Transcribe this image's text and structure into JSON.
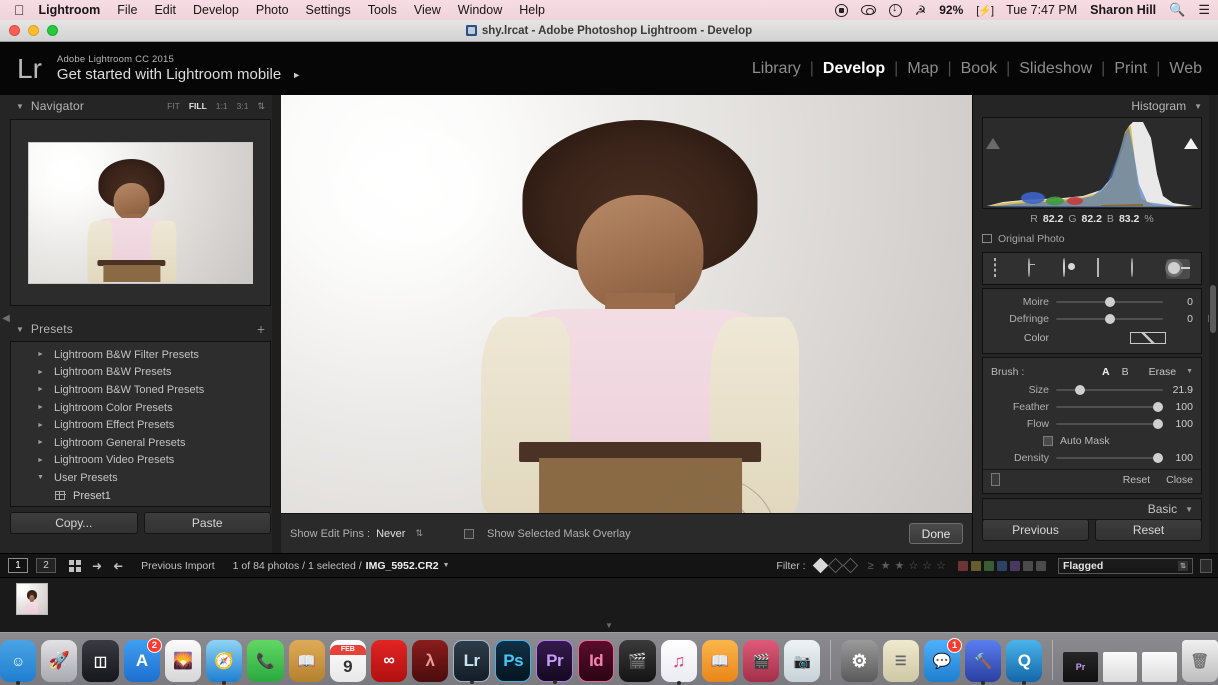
{
  "menubar": {
    "apple_icon": "apple-icon",
    "items": [
      {
        "label": "Lightroom",
        "bold": true
      },
      {
        "label": "File",
        "bold": false
      },
      {
        "label": "Edit",
        "bold": false
      },
      {
        "label": "Develop",
        "bold": false
      },
      {
        "label": "Photo",
        "bold": false
      },
      {
        "label": "Settings",
        "bold": false
      },
      {
        "label": "Tools",
        "bold": false
      },
      {
        "label": "View",
        "bold": false
      },
      {
        "label": "Window",
        "bold": false
      },
      {
        "label": "Help",
        "bold": false
      }
    ],
    "status": {
      "battery_percent": "92%",
      "clock": "Tue 7:47 PM",
      "user": "Sharon Hill",
      "search_icon": "search-icon",
      "notification_icon": "notification-center-icon",
      "wifi_icon": "wifi-icon",
      "record_icon": "screen-record-icon",
      "eye_icon": "display-icon",
      "download_icon": "download-icon",
      "plug_icon": "power-plug-icon"
    },
    "bg_color": "#f3d8df"
  },
  "window": {
    "title": "shy.lrcat - Adobe Photoshop Lightroom - Develop",
    "traffic_lights": [
      "close",
      "minimize",
      "zoom"
    ]
  },
  "app_header": {
    "logo": "Lr",
    "promo_small": "Adobe Lightroom CC 2015",
    "promo_large": "Get started with Lightroom mobile",
    "promo_arrow": "►",
    "modules": [
      {
        "label": "Library",
        "active": false
      },
      {
        "label": "Develop",
        "active": true
      },
      {
        "label": "Map",
        "active": false
      },
      {
        "label": "Book",
        "active": false
      },
      {
        "label": "Slideshow",
        "active": false
      },
      {
        "label": "Print",
        "active": false
      },
      {
        "label": "Web",
        "active": false
      }
    ]
  },
  "left_panel": {
    "navigator": {
      "title": "Navigator",
      "collapse_icon": "triangle-down-icon",
      "zoom_levels": [
        {
          "label": "FIT",
          "active": false
        },
        {
          "label": "FILL",
          "active": true
        },
        {
          "label": "1:1",
          "active": false
        },
        {
          "label": "3:1",
          "active": false
        }
      ],
      "stepper_icon": "stepper-icon"
    },
    "presets": {
      "title": "Presets",
      "collapse_icon": "triangle-down-icon",
      "add_icon": "plus-icon",
      "items": [
        {
          "label": "Lightroom B&W Filter Presets",
          "expanded": false,
          "child": false
        },
        {
          "label": "Lightroom B&W Presets",
          "expanded": false,
          "child": false
        },
        {
          "label": "Lightroom B&W Toned Presets",
          "expanded": false,
          "child": false
        },
        {
          "label": "Lightroom Color Presets",
          "expanded": false,
          "child": false
        },
        {
          "label": "Lightroom Effect Presets",
          "expanded": false,
          "child": false
        },
        {
          "label": "Lightroom General Presets",
          "expanded": false,
          "child": false
        },
        {
          "label": "Lightroom Video Presets",
          "expanded": false,
          "child": false
        },
        {
          "label": "User Presets",
          "expanded": true,
          "child": false
        },
        {
          "label": "Preset1",
          "expanded": false,
          "child": true
        }
      ]
    },
    "copy_button": "Copy...",
    "paste_button": "Paste"
  },
  "canvas": {
    "toolbar": {
      "show_edit_pins_label": "Show Edit Pins :",
      "show_edit_pins_value": "Never",
      "stepper_icon": "stepper-icon",
      "mask_overlay_label": "Show Selected Mask Overlay",
      "mask_overlay_checked": false,
      "done_button": "Done"
    },
    "brush_cursor": "brush-cursor"
  },
  "right_panel": {
    "histogram": {
      "title": "Histogram",
      "collapse_icon": "triangle-down-icon",
      "shadow_clip_icon": "shadow-clipping-icon",
      "highlight_clip_icon": "highlight-clipping-icon",
      "readout": [
        {
          "channel": "R",
          "value": "82.2"
        },
        {
          "channel": "G",
          "value": "82.2"
        },
        {
          "channel": "B",
          "value": "83.2"
        }
      ],
      "readout_unit": "%",
      "original_photo_label": "Original Photo",
      "original_photo_checked": false
    },
    "tools": [
      {
        "name": "crop-overlay-tool",
        "selected": false
      },
      {
        "name": "spot-removal-tool",
        "selected": false
      },
      {
        "name": "red-eye-correction-tool",
        "selected": false
      },
      {
        "name": "graduated-filter-tool",
        "selected": false
      },
      {
        "name": "radial-filter-tool",
        "selected": false
      },
      {
        "name": "adjustment-brush-tool",
        "selected": true
      }
    ],
    "effect_sliders": [
      {
        "label": "Moire",
        "value": "0",
        "pos": 50
      },
      {
        "label": "Defringe",
        "value": "0",
        "pos": 50
      }
    ],
    "color_label": "Color",
    "color_swatch": "color-swatch",
    "brush": {
      "label": "Brush :",
      "a_label": "A",
      "b_label": "B",
      "erase_label": "Erase",
      "active": "A",
      "menu_icon": "triangle-down-icon",
      "sliders": [
        {
          "label": "Size",
          "value": "21.9",
          "pos": 22
        },
        {
          "label": "Feather",
          "value": "100",
          "pos": 95
        },
        {
          "label": "Flow",
          "value": "100",
          "pos": 95
        },
        {
          "label": "Density",
          "value": "100",
          "pos": 95
        }
      ],
      "auto_mask_label": "Auto Mask",
      "auto_mask_checked": false
    },
    "switch_icon": "panel-switch-icon",
    "reset_link": "Reset",
    "close_link": "Close",
    "basic_title": "Basic",
    "basic_collapse_icon": "triangle-down-icon",
    "previous_button": "Previous",
    "reset_button": "Reset"
  },
  "filmstrip_bar": {
    "screen_buttons": [
      {
        "label": "1",
        "active": true
      },
      {
        "label": "2",
        "active": false
      }
    ],
    "grid_icon": "grid-view-icon",
    "back_icon": "arrow-left-icon",
    "forward_icon": "arrow-right-icon",
    "source": "Previous Import",
    "count_text": "1 of 84 photos / 1 selected /",
    "filename": "IMG_5952.CR2",
    "filename_dropdown_icon": "chevron-down-icon",
    "filter_label": "Filter :",
    "flags": [
      {
        "name": "flag-pick",
        "state": "on"
      },
      {
        "name": "flag-unflagged",
        "state": "off"
      },
      {
        "name": "flag-rejected",
        "state": "off"
      }
    ],
    "rating_prefix": "≥",
    "stars": 5,
    "color_labels": [
      "#a34a4a",
      "#9a8a3d",
      "#4f8a45",
      "#3f5f9a",
      "#6a4f8f",
      "#6e6e6e",
      "#6e6e6e"
    ],
    "filter_preset": "Flagged",
    "filter_dropdown_icon": "stepper-icon",
    "lock_icon": "filter-lock-icon"
  },
  "filmstrip": {
    "thumbnail": "filmstrip-thumbnail",
    "collapse_icon": "triangle-down-icon"
  },
  "dock": {
    "items": [
      {
        "name": "finder",
        "label": "",
        "color1": "#4aa3e3",
        "color2": "#1f7fd0",
        "running": true,
        "badge": null,
        "glyph": "face"
      },
      {
        "name": "launchpad",
        "label": "",
        "color1": "#d8d8dc",
        "color2": "#aaaab0",
        "running": false,
        "badge": null,
        "glyph": "rocket"
      },
      {
        "name": "mission-control",
        "label": "",
        "color1": "#2e2e36",
        "color2": "#17171c",
        "running": false,
        "badge": null,
        "glyph": "panes"
      },
      {
        "name": "app-store",
        "label": "",
        "color1": "#2f8fe8",
        "color2": "#1f6fd0",
        "running": false,
        "badge": "2",
        "glyph": "A"
      },
      {
        "name": "preview",
        "label": "",
        "color1": "#f2f2f2",
        "color2": "#d8d8d8",
        "running": false,
        "badge": null,
        "glyph": "photo"
      },
      {
        "name": "safari",
        "label": "",
        "color1": "#68c3f0",
        "color2": "#1f7fd0",
        "running": true,
        "badge": null,
        "glyph": "compass"
      },
      {
        "name": "facetime",
        "label": "",
        "color1": "#5ed25e",
        "color2": "#2fae43",
        "running": false,
        "badge": null,
        "glyph": "video"
      },
      {
        "name": "contacts",
        "label": "",
        "color1": "#d9a44f",
        "color2": "#b3822f",
        "running": false,
        "badge": null,
        "glyph": "book"
      },
      {
        "name": "calendar",
        "label": "9",
        "color1": "#ffffff",
        "color2": "#ededed",
        "running": false,
        "badge": null,
        "glyph": "cal"
      },
      {
        "name": "creative-cloud",
        "label": "",
        "color1": "#e02020",
        "color2": "#b81212",
        "running": false,
        "badge": null,
        "glyph": "cc"
      },
      {
        "name": "acrobat-reader",
        "label": "",
        "color1": "#7a1717",
        "color2": "#4a0d0d",
        "running": false,
        "badge": null,
        "glyph": "acro"
      },
      {
        "name": "lightroom",
        "label": "Lr",
        "color1": "#2a3642",
        "color2": "#16202a",
        "running": true,
        "badge": null,
        "glyph": "text"
      },
      {
        "name": "photoshop",
        "label": "Ps",
        "color1": "#0d2a3d",
        "color2": "#06151f",
        "running": false,
        "badge": null,
        "glyph": "text"
      },
      {
        "name": "premiere-pro",
        "label": "Pr",
        "color1": "#2a1440",
        "color2": "#15091f",
        "running": true,
        "badge": null,
        "glyph": "text"
      },
      {
        "name": "indesign",
        "label": "Id",
        "color1": "#4a0b24",
        "color2": "#2a0514",
        "running": false,
        "badge": null,
        "glyph": "text"
      },
      {
        "name": "final-cut-pro",
        "label": "",
        "color1": "#2b2b2b",
        "color2": "#141414",
        "running": false,
        "badge": null,
        "glyph": "clap"
      },
      {
        "name": "itunes",
        "label": "",
        "color1": "#ffffff",
        "color2": "#ebebf2",
        "running": true,
        "badge": null,
        "glyph": "note"
      },
      {
        "name": "ibooks",
        "label": "",
        "color1": "#f7a93c",
        "color2": "#e8861a",
        "running": false,
        "badge": null,
        "glyph": "ibook"
      },
      {
        "name": "photo-booth",
        "label": "",
        "color1": "#d94a6a",
        "color2": "#a32f4a",
        "running": false,
        "badge": null,
        "glyph": "booth"
      },
      {
        "name": "image-capture",
        "label": "",
        "color1": "#e6ecef",
        "color2": "#c6d2d8",
        "running": false,
        "badge": null,
        "glyph": "cam"
      },
      {
        "name": "system-preferences",
        "label": "",
        "color1": "#8c8c8c",
        "color2": "#5a5a5a",
        "running": false,
        "badge": null,
        "glyph": "gear"
      },
      {
        "name": "stickies",
        "label": "",
        "color1": "#e8e3c8",
        "color2": "#cfc8a4",
        "running": false,
        "badge": null,
        "glyph": "notes"
      },
      {
        "name": "messages",
        "label": "",
        "color1": "#3fa5f5",
        "color2": "#1f7fd0",
        "running": false,
        "badge": "1",
        "glyph": "bubble"
      },
      {
        "name": "xcode",
        "label": "",
        "color1": "#4c6fe0",
        "color2": "#2a3fa0",
        "running": true,
        "badge": null,
        "glyph": "hammer"
      },
      {
        "name": "quicktime",
        "label": "",
        "color1": "#3ea8e5",
        "color2": "#1466a8",
        "running": true,
        "badge": null,
        "glyph": "q"
      }
    ],
    "docs": [
      {
        "name": "premiere-document",
        "color1": "#1a1a1a",
        "color2": "#101010"
      },
      {
        "name": "text-document",
        "color1": "#f6f6f6",
        "color2": "#dddddd"
      },
      {
        "name": "downloads-stack",
        "color1": "#f6f6f6",
        "color2": "#dcdcdc"
      }
    ],
    "trash": {
      "name": "trash",
      "color1": "#e8e8e8",
      "color2": "#bdbdbd"
    }
  }
}
